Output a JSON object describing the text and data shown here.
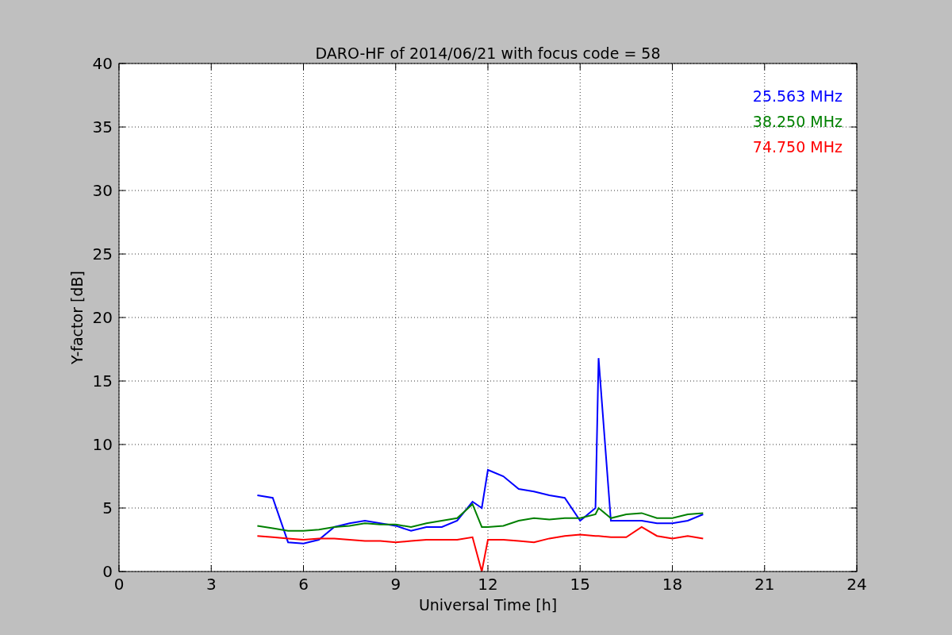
{
  "chart_data": {
    "type": "line",
    "title": "DARO-HF of 2014/06/21 with focus code = 58",
    "xlabel": "Universal Time [h]",
    "ylabel": "Y-factor [dB]",
    "x": [
      4.5,
      5,
      5.5,
      6,
      6.5,
      7,
      7.5,
      8,
      8.5,
      9,
      9.5,
      10,
      10.5,
      11,
      11.5,
      11.8,
      12,
      12.5,
      13,
      13.5,
      14,
      14.5,
      15,
      15.5,
      15.6,
      16,
      16.5,
      17,
      17.5,
      18,
      18.5,
      19
    ],
    "series": [
      {
        "name": "25.563 MHz",
        "color": "#0000ff",
        "values": [
          6,
          5.8,
          2.3,
          2.2,
          2.5,
          3.5,
          3.8,
          4,
          3.8,
          3.6,
          3.2,
          3.5,
          3.5,
          4,
          5.5,
          5,
          8,
          7.5,
          6.5,
          6.3,
          6,
          5.8,
          4,
          5,
          16.8,
          4,
          4,
          4,
          3.8,
          3.8,
          4,
          4.5
        ]
      },
      {
        "name": "38.250 MHz",
        "color": "#008000",
        "values": [
          3.6,
          3.4,
          3.2,
          3.2,
          3.3,
          3.5,
          3.6,
          3.8,
          3.7,
          3.7,
          3.5,
          3.8,
          4,
          4.2,
          5.3,
          3.5,
          3.5,
          3.6,
          4,
          4.2,
          4.1,
          4.2,
          4.2,
          4.5,
          5,
          4.2,
          4.5,
          4.6,
          4.2,
          4.2,
          4.5,
          4.6
        ]
      },
      {
        "name": "74.750 MHz",
        "color": "#ff0000",
        "values": [
          2.8,
          2.7,
          2.6,
          2.5,
          2.6,
          2.6,
          2.5,
          2.4,
          2.4,
          2.3,
          2.4,
          2.5,
          2.5,
          2.5,
          2.7,
          0,
          2.5,
          2.5,
          2.4,
          2.3,
          2.6,
          2.8,
          2.9,
          2.8,
          2.8,
          2.7,
          2.7,
          3.5,
          2.8,
          2.6,
          2.8,
          2.6
        ]
      }
    ],
    "xlim": [
      0,
      24
    ],
    "ylim": [
      0,
      40
    ],
    "grid": true,
    "xticks": [
      0,
      3,
      6,
      9,
      12,
      15,
      18,
      21,
      24
    ],
    "yticks": [
      0,
      5,
      10,
      15,
      20,
      25,
      30,
      35,
      40
    ]
  }
}
